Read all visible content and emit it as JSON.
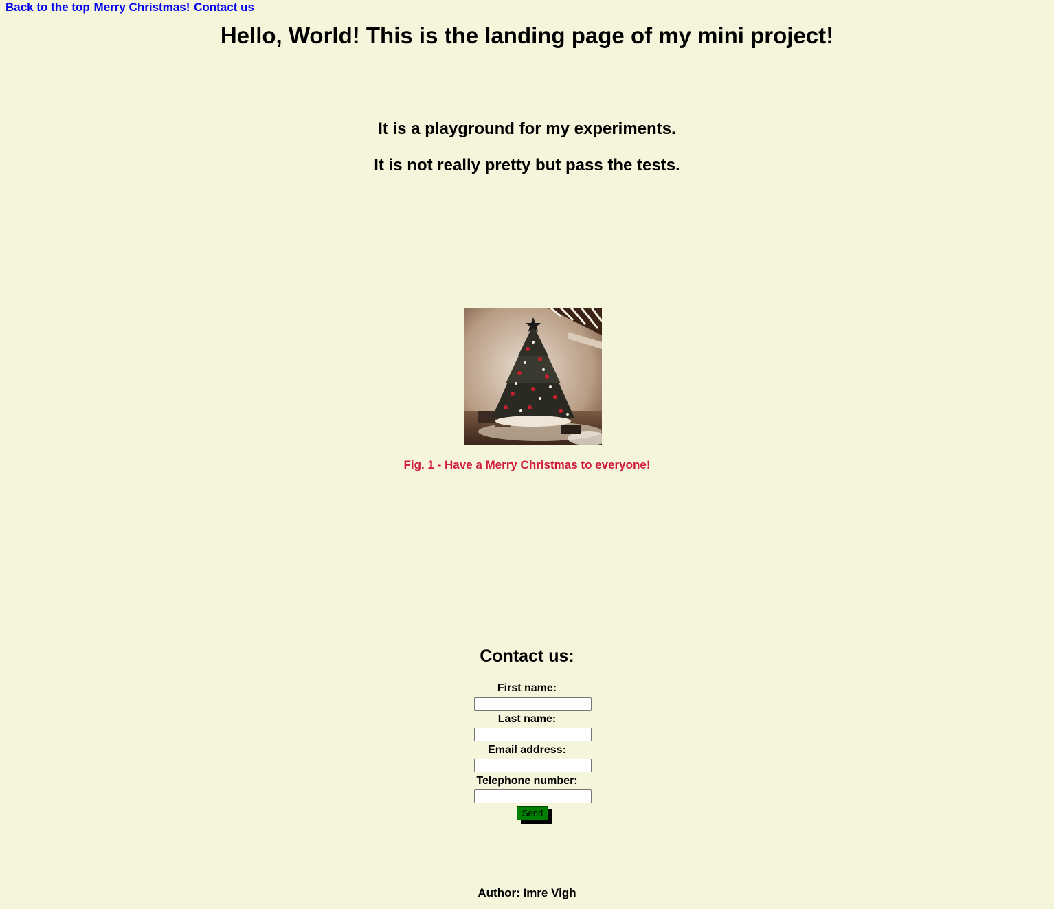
{
  "nav": {
    "links": [
      "Back to the top",
      "Merry Christmas!",
      "Contact us"
    ]
  },
  "header": {
    "title": "Hello, World! This is the landing page of my mini project!"
  },
  "intro": {
    "line1": "It is a playground for my experiments.",
    "line2": "It is not really pretty but pass the tests."
  },
  "figure": {
    "caption": "Fig. 1 - Have a Merry Christmas to everyone!",
    "caption_color": "#d01a3c"
  },
  "contact": {
    "heading": "Contact us:",
    "fields": [
      {
        "label": "First name:",
        "value": ""
      },
      {
        "label": "Last name:",
        "value": ""
      },
      {
        "label": "Email address:",
        "value": ""
      },
      {
        "label": "Telephone number:",
        "value": ""
      }
    ],
    "send_label": "Send",
    "send_color": "#008000"
  },
  "footer": {
    "author": "Author: Imre Vigh"
  },
  "colors": {
    "background": "#f5f5dc",
    "link": "#0000ee"
  }
}
